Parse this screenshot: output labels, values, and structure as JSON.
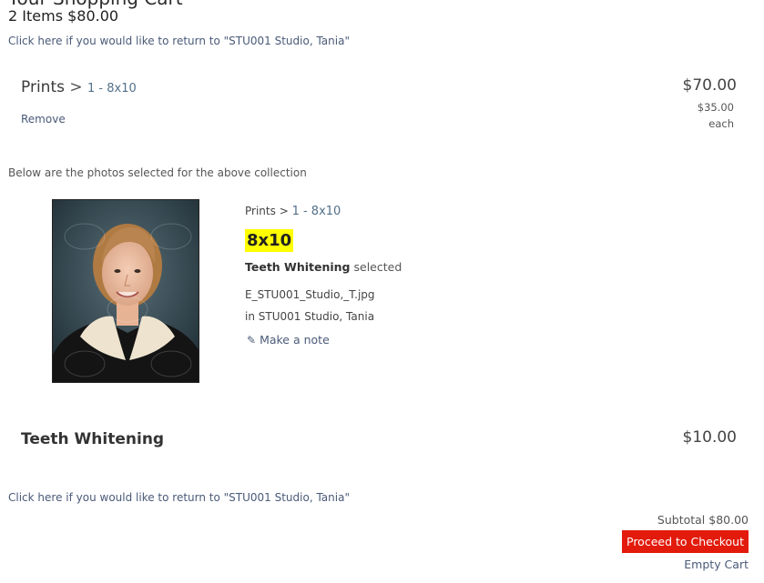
{
  "header": {
    "title_cut": "Your Shopping Cart",
    "items_total": "2 Items $80.00",
    "return_link": "Click here if you would like to return to \"STU001 Studio, Tania\""
  },
  "line_item": {
    "category": "Prints",
    "separator": ">",
    "subcategory": "1 - 8x10",
    "remove_label": "Remove",
    "price": "$70.00",
    "unit_price": "$35.00",
    "unit_label": "each"
  },
  "collection_note": "Below are the photos selected for the above collection",
  "photo_detail": {
    "category": "Prints",
    "separator": ">",
    "subcategory": "1 - 8x10",
    "size": "8x10",
    "option_name": "Teeth Whitening",
    "option_status": "selected",
    "filename": "E_STU001_Studio,_T.jpg",
    "location": "in STU001 Studio, Tania",
    "note_icon": "pen-icon",
    "note_label": "Make a note"
  },
  "addon": {
    "title": "Teeth Whitening",
    "price": "$10.00"
  },
  "footer": {
    "return_link": "Click here if you would like to return to \"STU001 Studio, Tania\"",
    "subtotal": "Subtotal $80.00",
    "checkout_label": "Proceed to Checkout",
    "empty_cart_label": "Empty Cart"
  },
  "colors": {
    "checkout_button": "#e21b0c",
    "highlight": "#ffff00",
    "link": "#4a5a78"
  }
}
